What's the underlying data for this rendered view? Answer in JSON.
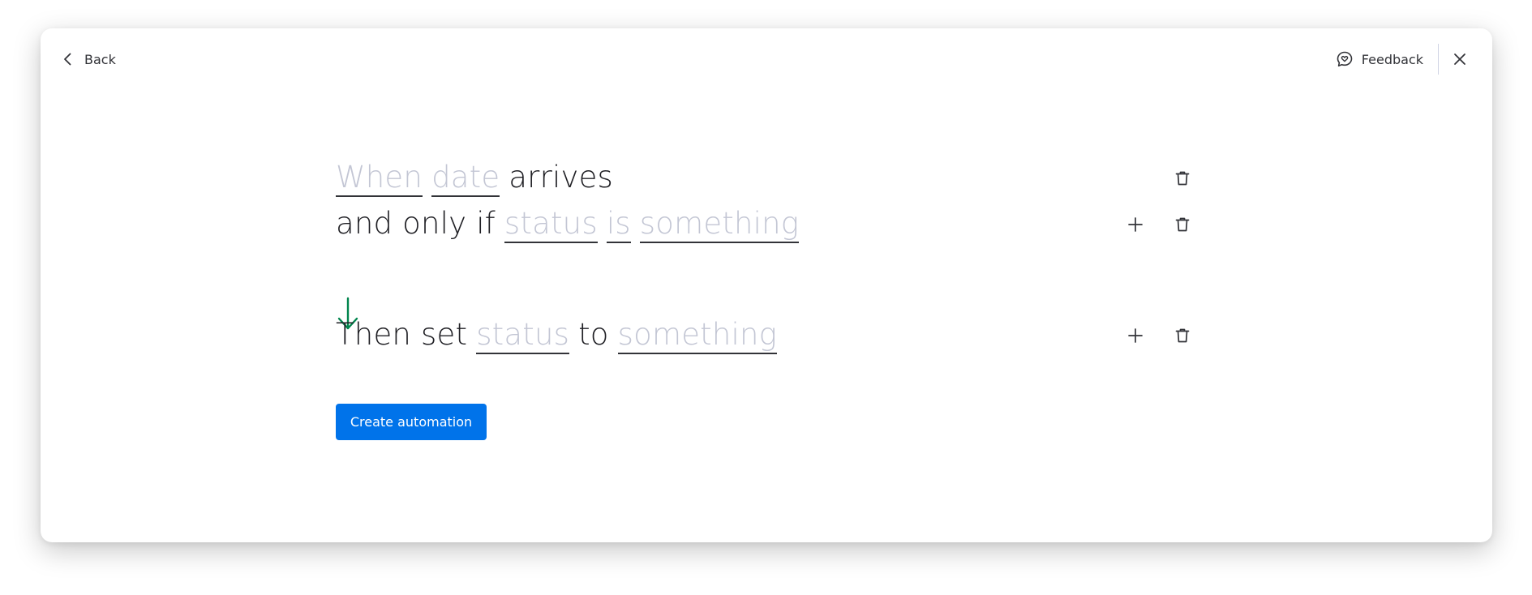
{
  "header": {
    "back_label": "Back",
    "feedback_label": "Feedback"
  },
  "builder": {
    "trigger": {
      "words": [
        "When",
        "date",
        "arrives"
      ]
    },
    "condition": {
      "prefix": "and only if",
      "field": "status",
      "operator": "is",
      "value": "something"
    },
    "action": {
      "prefix": "Then set",
      "field": "status",
      "connector": "to",
      "value": "something"
    }
  },
  "create_button_label": "Create automation",
  "colors": {
    "accent": "#0073ea",
    "arrow": "#00854d",
    "placeholder_token": "#c3c6d4",
    "text": "#1f1f24"
  },
  "icons": {
    "back": "chevron-left-icon",
    "feedback": "chat-heart-icon",
    "close": "close-icon",
    "add": "plus-icon",
    "delete": "trash-icon",
    "flow": "arrow-down-icon"
  }
}
